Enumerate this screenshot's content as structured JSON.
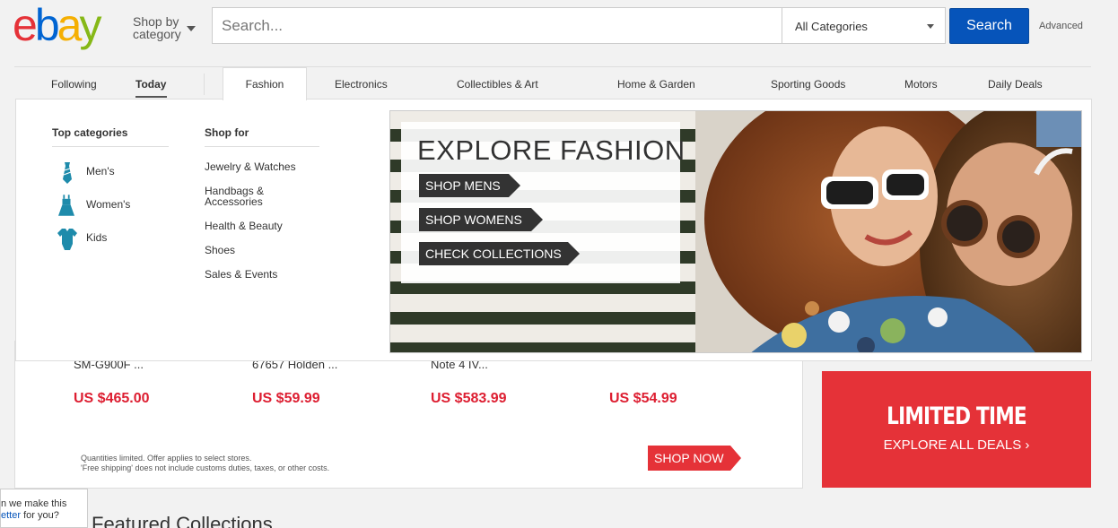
{
  "header": {
    "logo_letters": [
      "e",
      "b",
      "a",
      "y"
    ],
    "logo_colors": [
      "#e53238",
      "#0064d2",
      "#f5af02",
      "#86b817"
    ],
    "shop_by_line1": "Shop by",
    "shop_by_line2": "category",
    "search_placeholder": "Search...",
    "category_select": "All Categories",
    "search_button": "Search",
    "advanced": "Advanced"
  },
  "nav": {
    "items": [
      "Following",
      "Today",
      "Fashion",
      "Electronics",
      "Collectibles & Art",
      "Home & Garden",
      "Sporting Goods",
      "Motors",
      "Daily Deals"
    ],
    "active": "Fashion"
  },
  "mega_menu": {
    "top_categories_heading": "Top categories",
    "top_categories": [
      {
        "label": "Men's",
        "icon": "tie-icon"
      },
      {
        "label": "Women's",
        "icon": "dress-icon"
      },
      {
        "label": "Kids",
        "icon": "onesie-icon"
      }
    ],
    "shop_for_heading": "Shop for",
    "shop_for": [
      "Jewelry & Watches",
      "Handbags & Accessories",
      "Health & Beauty",
      "Shoes",
      "Sales & Events"
    ],
    "banner": {
      "title": "EXPLORE FASHION",
      "links": [
        "SHOP MENS",
        "SHOP WOMENS",
        "CHECK COLLECTIONS"
      ]
    }
  },
  "products": [
    {
      "name": "SM-G900F ...",
      "price": "US $465.00"
    },
    {
      "name": "67657 Holden ...",
      "price": "US $59.99"
    },
    {
      "name": "Note 4 IV...",
      "price": "US $583.99"
    },
    {
      "name": "",
      "price": "US $54.99"
    }
  ],
  "deals": {
    "disclaimer_line1": "Quantities limited. Offer applies to select stores.",
    "disclaimer_line2": "'Free shipping' does not include customs duties, taxes, or other costs.",
    "shop_now": "SHOP NOW",
    "limited_title": "LIMITED TIME",
    "limited_sub": "EXPLORE ALL DEALS ›"
  },
  "featured": "Featured Collections",
  "feedback": {
    "line1": "n we make this",
    "line2_link": "etter",
    "line2_rest": " for you?"
  },
  "colors": {
    "search_blue": "#0654ba",
    "price_red": "#dd1e31",
    "deal_red": "#e53238",
    "category_teal": "#1e8bab"
  }
}
